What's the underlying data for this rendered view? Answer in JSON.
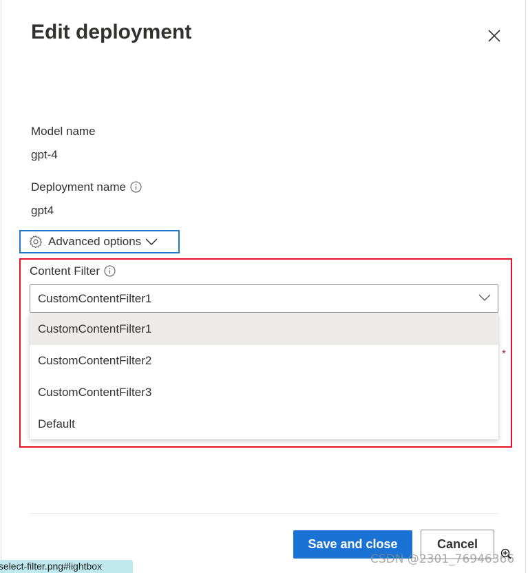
{
  "dialog": {
    "title": "Edit deployment"
  },
  "fields": {
    "model_name_label": "Model name",
    "model_name_value": "gpt-4",
    "deployment_name_label": "Deployment name",
    "deployment_name_value": "gpt4"
  },
  "advanced": {
    "label": "Advanced options"
  },
  "content_filter": {
    "label": "Content Filter",
    "selected": "CustomContentFilter1",
    "options": [
      "CustomContentFilter1",
      "CustomContentFilter2",
      "CustomContentFilter3",
      "Default"
    ],
    "required_mark": "*"
  },
  "footer": {
    "save_label": "Save and close",
    "cancel_label": "Cancel"
  },
  "overlay": {
    "url_tip": "/select-filter.png#lightbox",
    "watermark": "CSDN @2301_76946366"
  },
  "colors": {
    "primary": "#1a73d4",
    "focus_outline": "#1f79c4",
    "highlight_box": "#e81123"
  }
}
